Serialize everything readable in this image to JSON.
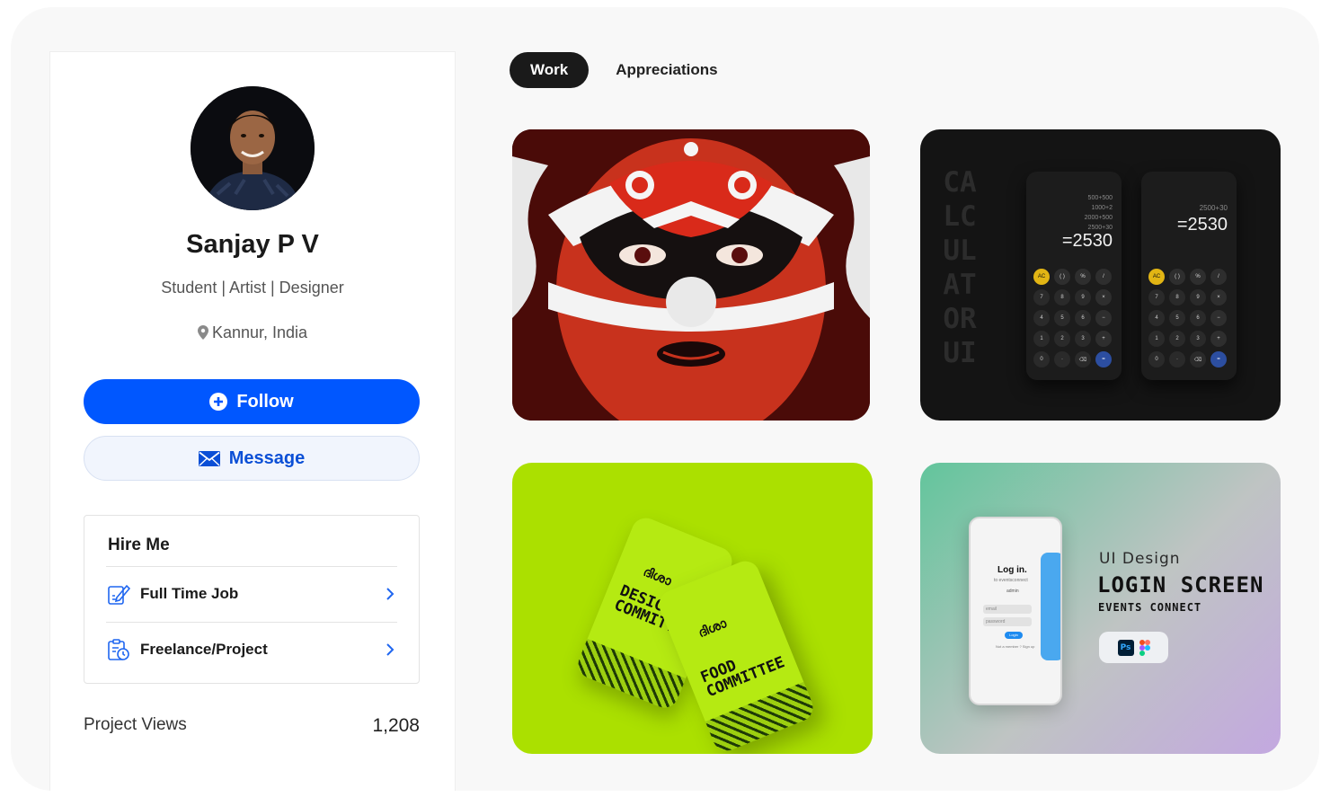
{
  "profile": {
    "name": "Sanjay P V",
    "role": "Student | Artist | Designer",
    "location": "Kannur, India",
    "follow_label": "Follow",
    "message_label": "Message"
  },
  "hire": {
    "title": "Hire Me",
    "options": [
      {
        "label": "Full Time Job",
        "icon": "pen-paper-icon"
      },
      {
        "label": "Freelance/Project",
        "icon": "clipboard-clock-icon"
      }
    ]
  },
  "stats": {
    "label": "Project Views",
    "value": "1,208"
  },
  "tabs": [
    {
      "label": "Work",
      "active": true
    },
    {
      "label": "Appreciations",
      "active": false
    }
  ],
  "projects": {
    "calculator": {
      "side_text": [
        "CA",
        "LC",
        "UL",
        "AT",
        "OR",
        "UI"
      ],
      "history_left": [
        "500+500",
        "1000+2",
        "2000+500",
        "2500+30"
      ],
      "result_left": "=2530",
      "history_right": [
        "2500+30"
      ],
      "result_right": "=2530",
      "keys": [
        "AC",
        "( )",
        "%",
        "/",
        "7",
        "8",
        "9",
        "×",
        "4",
        "5",
        "6",
        "−",
        "1",
        "2",
        "3",
        "+",
        "0",
        "·",
        "⌫",
        "="
      ]
    },
    "cards": {
      "brand": "ദിശാ",
      "card1": "DESIGN\nCOMMITTEE",
      "card2": "FOOD\nCOMMITTEE"
    },
    "login": {
      "label": "UI Design",
      "title": "LOGIN SCREEN",
      "subtitle": "EVENTS CONNECT",
      "phone_title": "Log in.",
      "phone_sub": "to eventsconnect",
      "phone_admin": "admin",
      "phone_email": "email",
      "phone_password": "password",
      "phone_button": "Login",
      "phone_footer": "Not a member ? Sign up",
      "tools": [
        "Ps",
        "figma-icon"
      ]
    }
  },
  "colors": {
    "accent": "#0057ff",
    "message_bg": "#f1f5fd",
    "tab_active": "#1a1a1a",
    "calc_tile": "#141414",
    "green_tile": "#abe000"
  }
}
